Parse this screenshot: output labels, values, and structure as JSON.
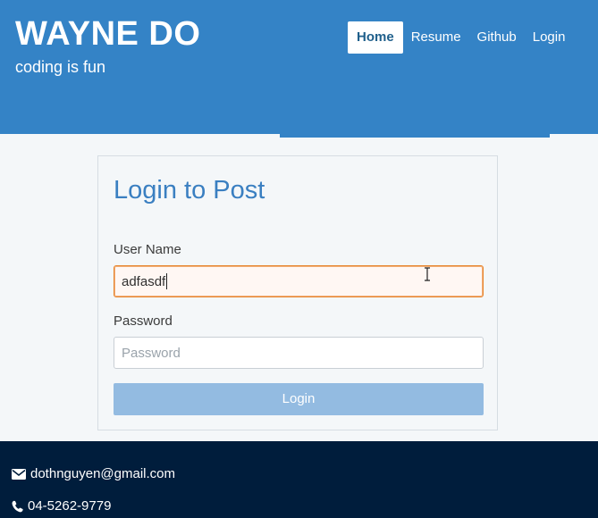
{
  "header": {
    "title": "WAYNE DO",
    "subtitle": "coding is fun",
    "nav": [
      {
        "label": "Home",
        "active": true
      },
      {
        "label": "Resume",
        "active": false
      },
      {
        "label": "Github",
        "active": false
      },
      {
        "label": "Login",
        "active": false
      }
    ]
  },
  "login_form": {
    "title": "Login to Post",
    "username_label": "User Name",
    "username_value": "adfasdf",
    "password_label": "Password",
    "password_placeholder": "Password",
    "submit_label": "Login"
  },
  "footer": {
    "email": "dothnguyen@gmail.com",
    "phone": "04-5262-9779",
    "email_icon": "envelope-icon",
    "phone_icon": "phone-icon"
  },
  "colors": {
    "header_bg": "#3483c6",
    "footer_bg": "#001d3c",
    "accent": "#3a7fc1",
    "button_disabled": "#93bbe1"
  }
}
